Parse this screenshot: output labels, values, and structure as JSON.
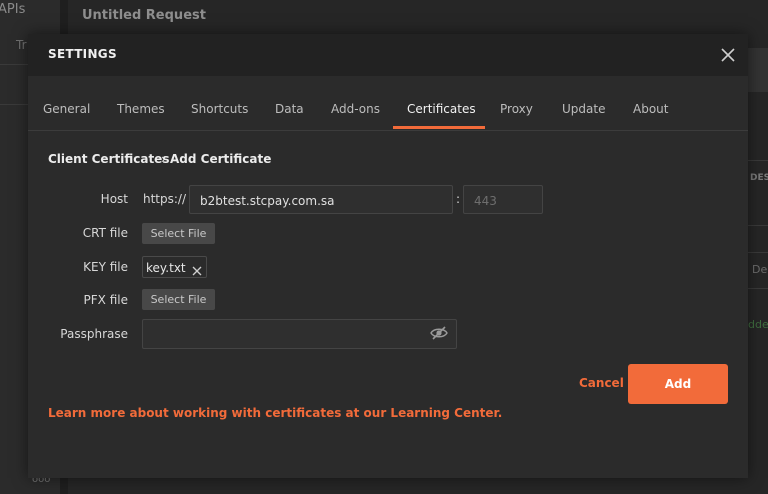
{
  "background": {
    "sidebar_apis": "APIs",
    "sidebar_tr": "Tr",
    "sidebar_dots": "ooo",
    "request_title": "Untitled Request",
    "right_des": "DES",
    "right_de": "De",
    "right_dden": "dden"
  },
  "dialog": {
    "title": "SETTINGS",
    "tabs": [
      {
        "label": "General"
      },
      {
        "label": "Themes"
      },
      {
        "label": "Shortcuts"
      },
      {
        "label": "Data"
      },
      {
        "label": "Add-ons"
      },
      {
        "label": "Certificates"
      },
      {
        "label": "Proxy"
      },
      {
        "label": "Update"
      },
      {
        "label": "About"
      }
    ],
    "active_tab": "Certificates",
    "breadcrumb": {
      "parent": "Client Certificates",
      "separator": "›",
      "current": "Add Certificate"
    },
    "form": {
      "host_label": "Host",
      "host_prefix": "https://",
      "host_value": "b2btest.stcpay.com.sa",
      "port_separator": ":",
      "port_placeholder": "443",
      "crt_label": "CRT file",
      "crt_button": "Select File",
      "key_label": "KEY file",
      "key_file": "key.txt",
      "pfx_label": "PFX file",
      "pfx_button": "Select File",
      "passphrase_label": "Passphrase",
      "passphrase_value": ""
    },
    "cancel_label": "Cancel",
    "add_label": "Add",
    "learn_more": "Learn more about working with certificates at our Learning Center."
  },
  "colors": {
    "accent": "#f26b3a",
    "dialog_bg": "#2b2b2b",
    "header_bg": "#222222",
    "text": "#d8d8d8"
  },
  "icons": [
    "close-icon",
    "remove-file-icon",
    "eye-off-icon"
  ]
}
